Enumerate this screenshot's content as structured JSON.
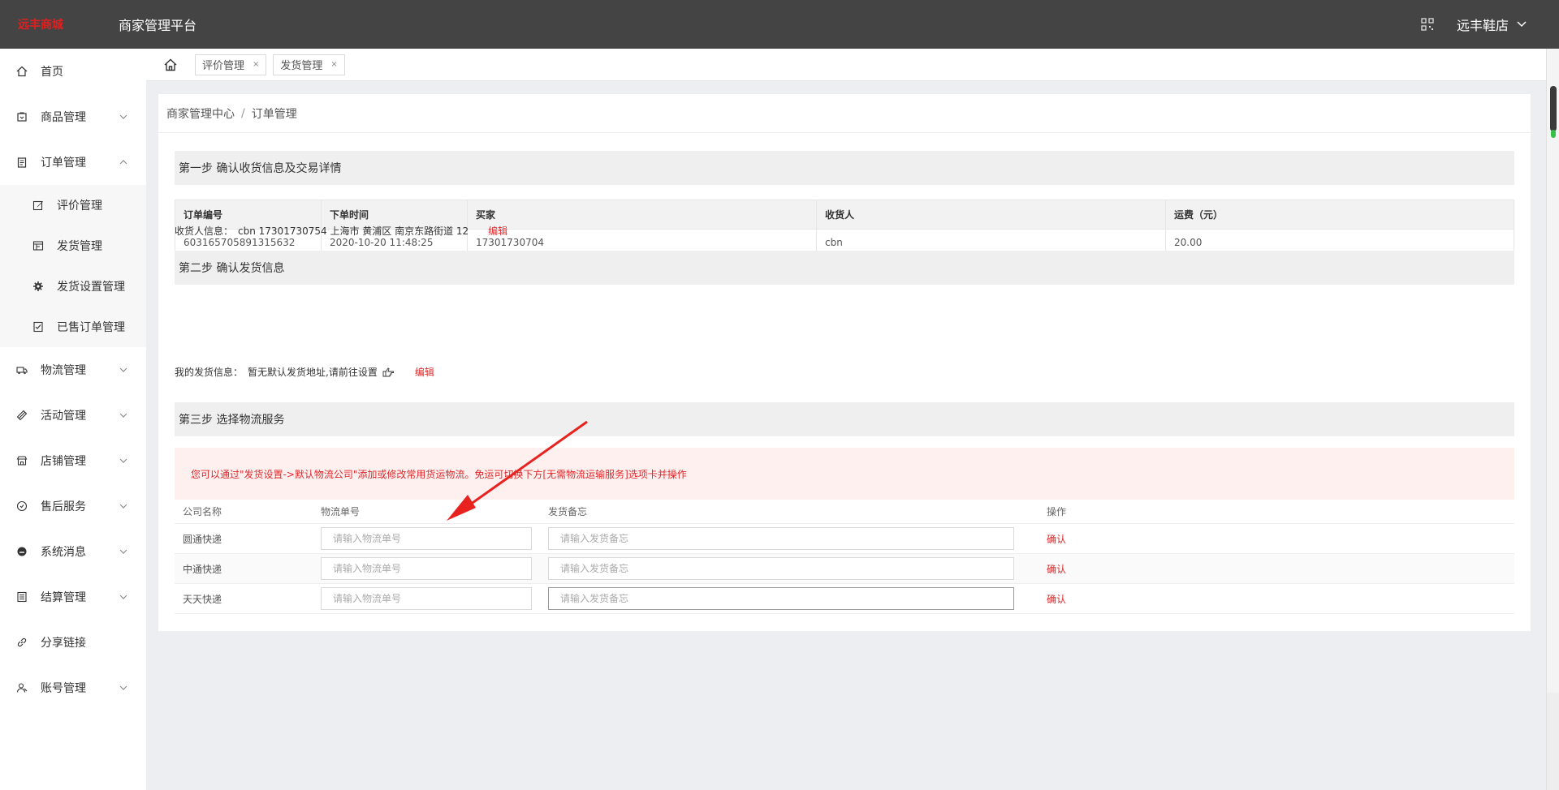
{
  "header": {
    "logo_text": "远丰商城",
    "platform_title": "商家管理平台",
    "shop_name": "远丰鞋店"
  },
  "sidebar": {
    "items": [
      {
        "label": "首页",
        "icon": "home-icon"
      },
      {
        "label": "商品管理",
        "icon": "goods-icon"
      },
      {
        "label": "订单管理",
        "icon": "order-icon"
      },
      {
        "label": "物流管理",
        "icon": "logistics-icon"
      },
      {
        "label": "活动管理",
        "icon": "activity-icon"
      },
      {
        "label": "店铺管理",
        "icon": "store-icon"
      },
      {
        "label": "售后服务",
        "icon": "aftersale-icon"
      },
      {
        "label": "系统消息",
        "icon": "message-icon"
      },
      {
        "label": "结算管理",
        "icon": "settlement-icon"
      },
      {
        "label": "分享链接",
        "icon": "link-icon"
      },
      {
        "label": "账号管理",
        "icon": "account-icon"
      }
    ],
    "order_sub": [
      {
        "label": "评价管理",
        "icon": "edit-icon"
      },
      {
        "label": "发货管理",
        "icon": "ship-icon"
      },
      {
        "label": "发货设置管理",
        "icon": "gear-icon"
      },
      {
        "label": "已售订单管理",
        "icon": "sold-icon"
      }
    ]
  },
  "tabs": [
    {
      "label": "评价管理",
      "close": "×"
    },
    {
      "label": "发货管理",
      "close": "×"
    }
  ],
  "breadcrumb": {
    "root": "商家管理中心",
    "sep": "/",
    "current": "订单管理"
  },
  "step1": {
    "title": "第一步 确认收货信息及交易详情",
    "columns": [
      "订单编号",
      "下单时间",
      "买家",
      "收货人",
      "运费（元）"
    ],
    "row": [
      "603165705891315632",
      "2020-10-20 11:48:25",
      "17301730704",
      "cbn",
      "20.00"
    ],
    "receiver_label": "收货人信息：",
    "receiver_value": "cbn 17301730754 上海市 黄浦区 南京东路街道 12",
    "edit_label": "编辑"
  },
  "step2": {
    "title": "第二步 确认发货信息",
    "sender_label": "我的发货信息：",
    "sender_value": "暂无默认发货地址,请前往设置",
    "edit_label": "编辑"
  },
  "step3": {
    "title": "第三步 选择物流服务",
    "notice": "您可以通过\"发货设置->默认物流公司\"添加或修改常用货运物流。免运可切换下方[无需物流运输服务]选项卡并操作",
    "columns": [
      "公司名称",
      "物流单号",
      "发货备忘",
      "操作"
    ],
    "rows": [
      {
        "company": "圆通快递",
        "track_placeholder": "请输入物流单号",
        "note_placeholder": "请输入发货备忘",
        "action": "确认"
      },
      {
        "company": "中通快递",
        "track_placeholder": "请输入物流单号",
        "note_placeholder": "请输入发货备忘",
        "action": "确认"
      },
      {
        "company": "天天快递",
        "track_placeholder": "请输入物流单号",
        "note_placeholder": "请输入发货备忘",
        "action": "确认"
      }
    ]
  },
  "colors": {
    "topbar": "#444444",
    "accent_red": "#e0282a",
    "notice_bg": "#fff0f0"
  }
}
